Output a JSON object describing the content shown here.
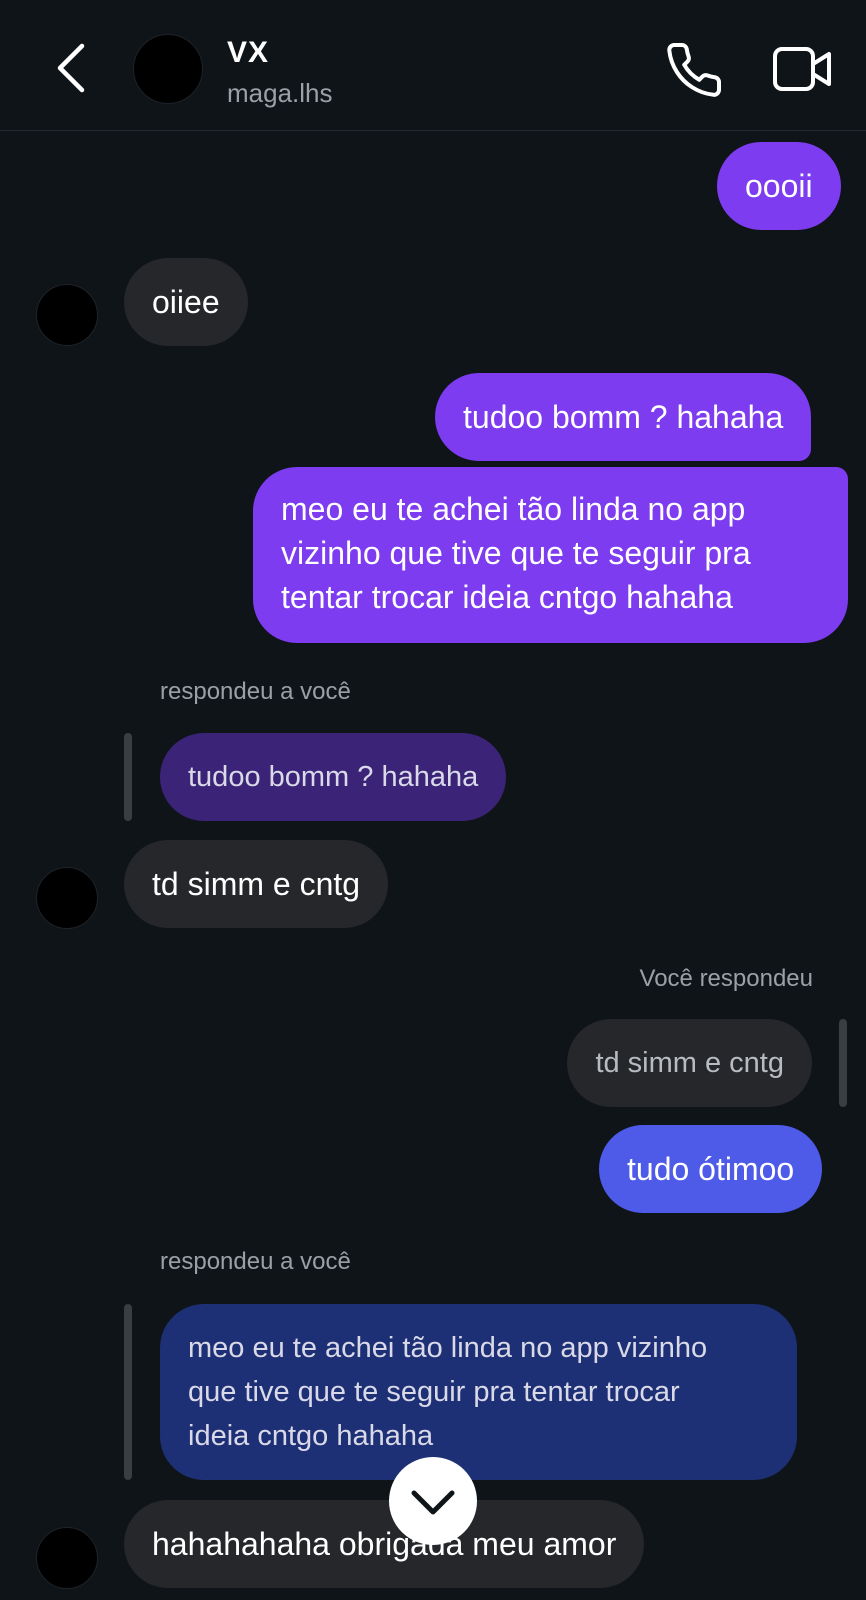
{
  "header": {
    "name": "VX",
    "username": "maga.lhs"
  },
  "messages": {
    "m1": "oooii",
    "m2": "oiiee",
    "m3": "tudoo bomm ? hahaha",
    "m4_l1": "meo eu te achei tão linda no app",
    "m4_l2": "vizinho que tive que te seguir pra",
    "m4_l3": "tentar trocar ideia cntgo hahaha",
    "reply1_label": "respondeu a você",
    "reply1_quote": "tudoo bomm ? hahaha",
    "m5": "td simm e cntg",
    "reply2_label": "Você respondeu",
    "reply2_quote": "td simm e cntg",
    "m6": "tudo ótimoo",
    "reply3_label": "respondeu a você",
    "reply3_quote_l1": "meo eu te achei tão linda no app vizinho",
    "reply3_quote_l2": "que tive que te seguir pra tentar trocar",
    "reply3_quote_l3": "ideia cntgo hahaha",
    "m7": "hahahahaha obrigada meu amor"
  },
  "colors": {
    "background": "#0f1419",
    "sent_purple": "#7d3cf0",
    "sent_blue": "#4e5ae8",
    "received": "#25272b",
    "quoted_purple": "#3b2478",
    "quoted_blue": "#1e3075"
  },
  "icons": {
    "back": "chevron-left-icon",
    "call": "phone-icon",
    "video": "video-camera-icon",
    "scroll": "chevron-down-icon"
  }
}
